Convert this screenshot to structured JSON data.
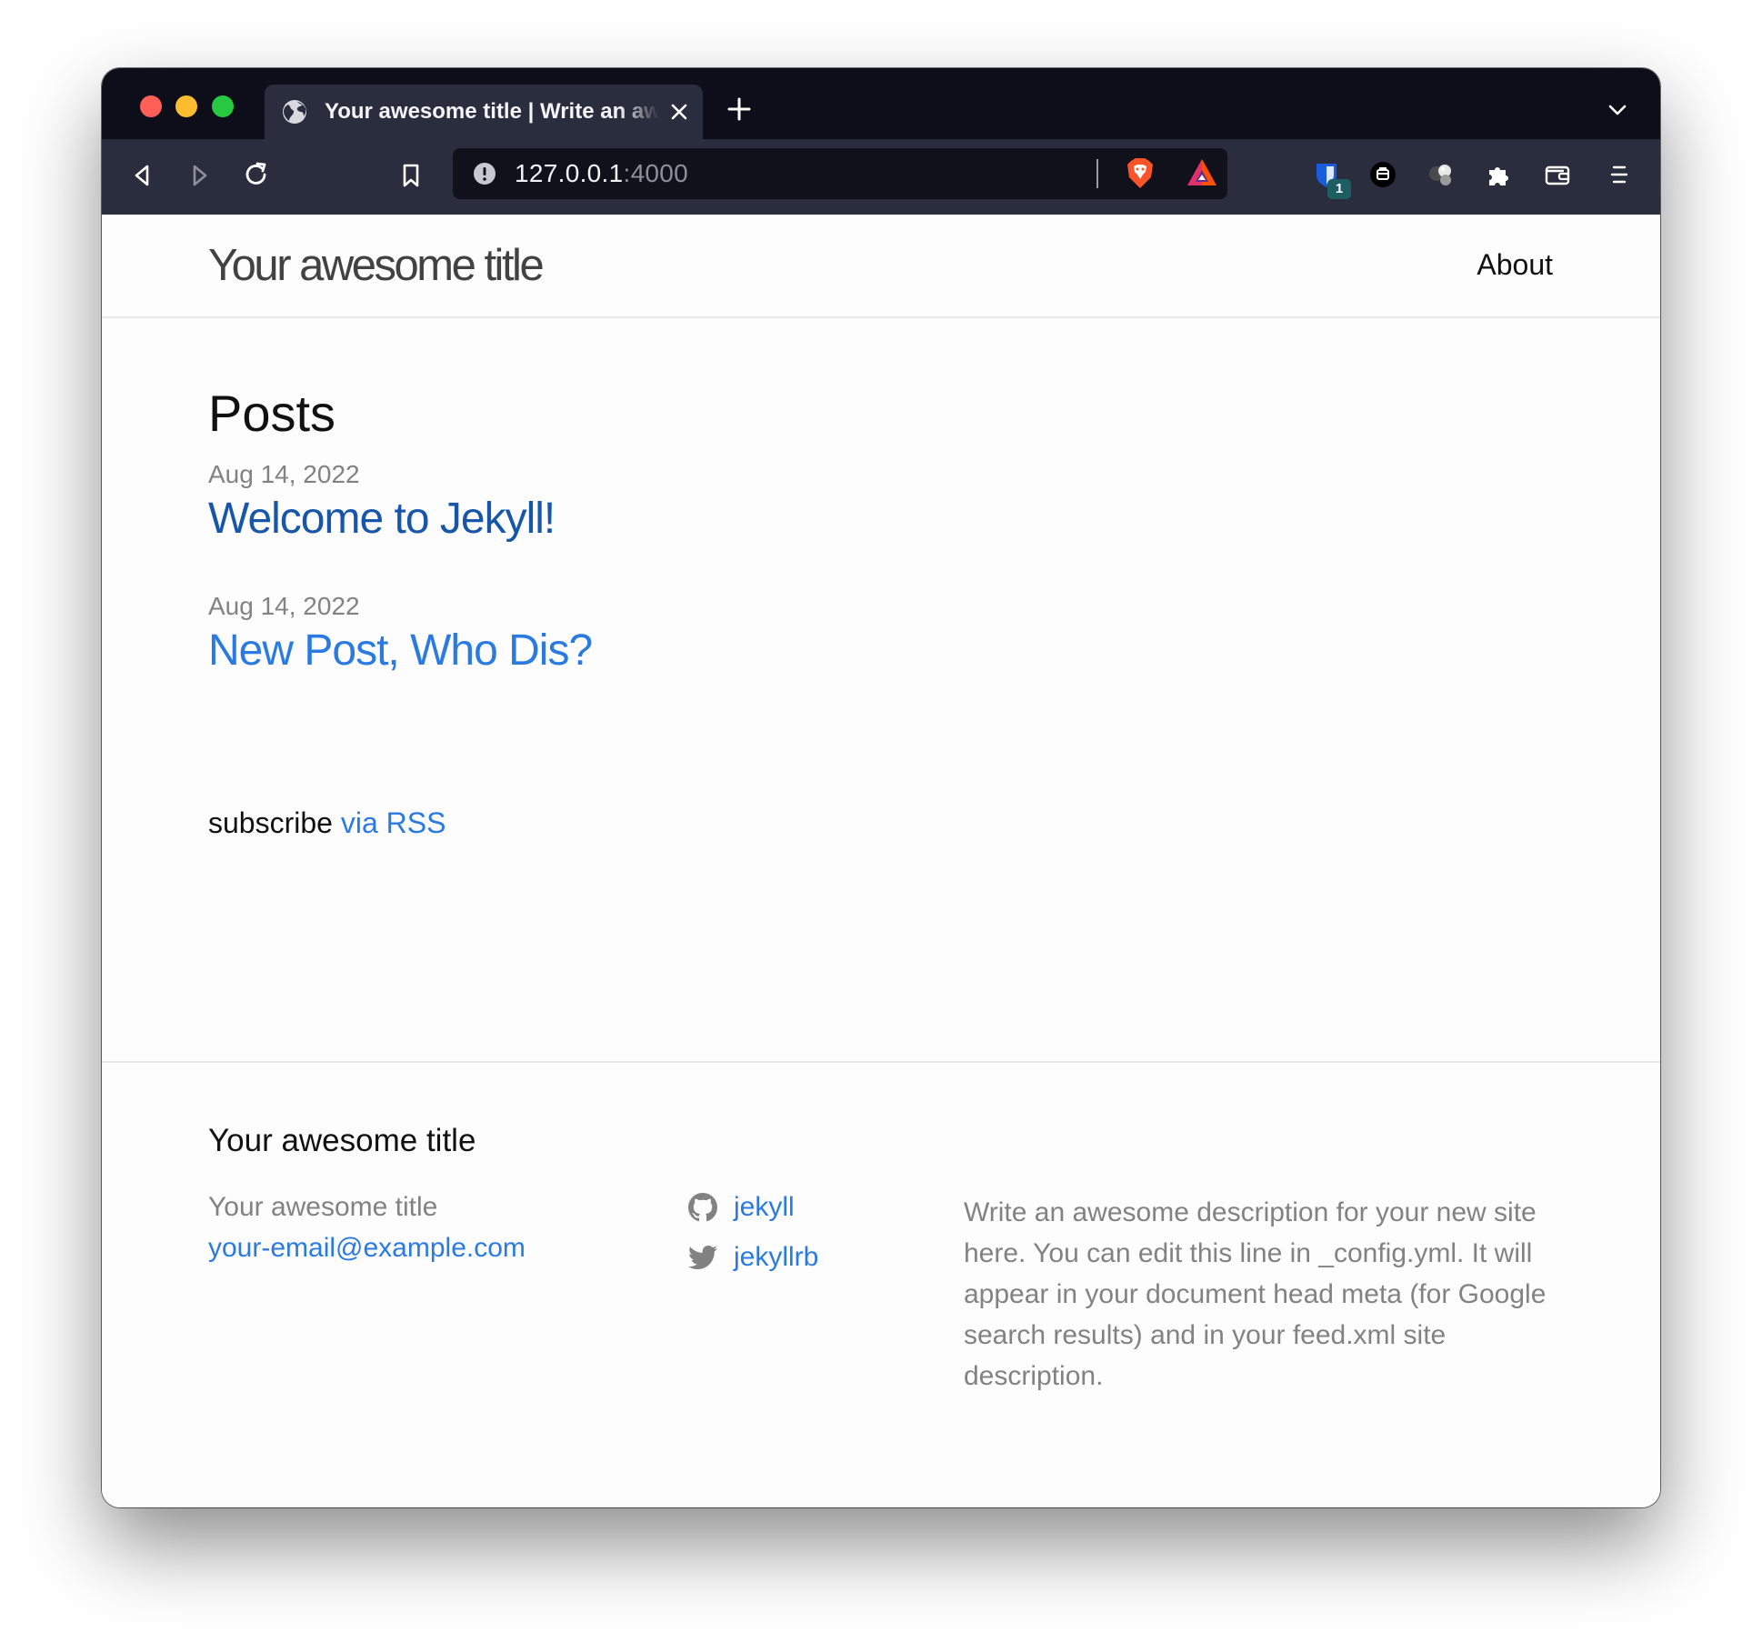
{
  "browser": {
    "tab": {
      "title": "Your awesome title | Write an awesome description for your new site here."
    },
    "url": {
      "host": "127.0.0.1",
      "port": ":4000"
    },
    "extension_badge": "1"
  },
  "site": {
    "header_title": "Your awesome title",
    "nav": {
      "about": "About"
    },
    "posts_heading": "Posts",
    "posts": [
      {
        "date": "Aug 14, 2022",
        "title": "Welcome to Jekyll!"
      },
      {
        "date": "Aug 14, 2022",
        "title": "New Post, Who Dis?"
      }
    ],
    "subscribe": {
      "text": "subscribe ",
      "link": "via RSS"
    },
    "footer": {
      "heading": "Your awesome title",
      "name": "Your awesome title",
      "email": "your-email@example.com",
      "github": "jekyll",
      "twitter": "jekyllrb",
      "description": "Write an awesome description for your new site here. You can edit this line in _config.yml. It will appear in your document head meta (for Google search results) and in your feed.xml site description."
    }
  },
  "colors": {
    "link": "#2a7ae2",
    "visited_link": "#1756a9",
    "muted_text": "#828282",
    "browser_chrome": "#2a2d3d"
  }
}
